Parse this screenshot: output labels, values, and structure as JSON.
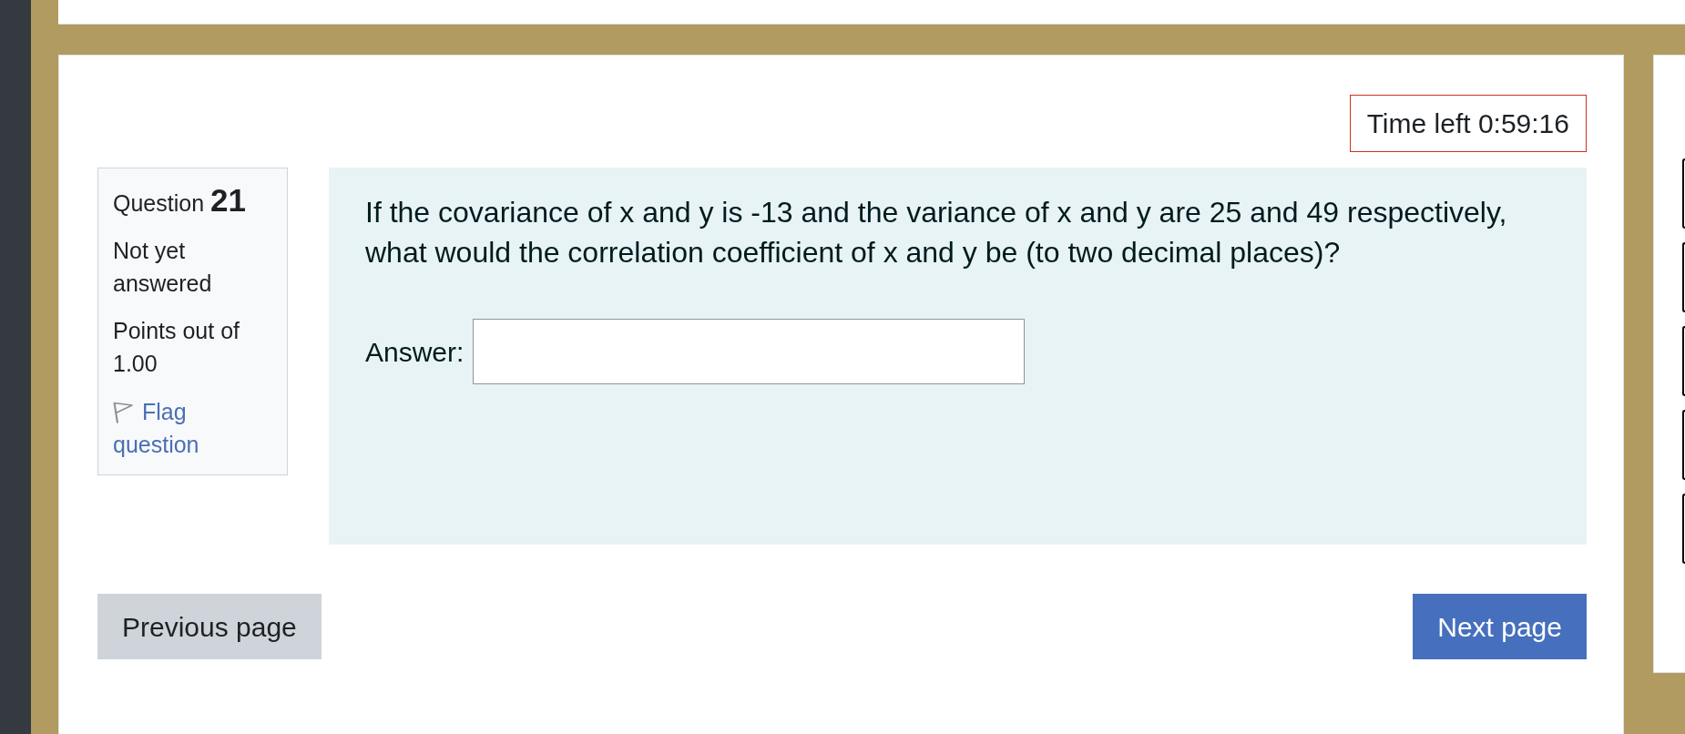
{
  "timer": {
    "text": "Time left 0:59:16"
  },
  "question_info": {
    "title": "Question",
    "number": "21",
    "status": "Not yet answered",
    "points": "Points out of 1.00",
    "flag": {
      "label": "Flag question",
      "flagged": false
    }
  },
  "question": {
    "text": "If the covariance of x and y is -13 and the variance of x and y are 25 and 49 respectively, what would the correlation coefficient of x and y be (to two decimal places)?",
    "answer": {
      "label": "Answer:"
    }
  },
  "buttons": [
    {
      "label": "Previous page",
      "kind": "secondary"
    },
    {
      "label": "Next page",
      "kind": "primary"
    }
  ]
}
